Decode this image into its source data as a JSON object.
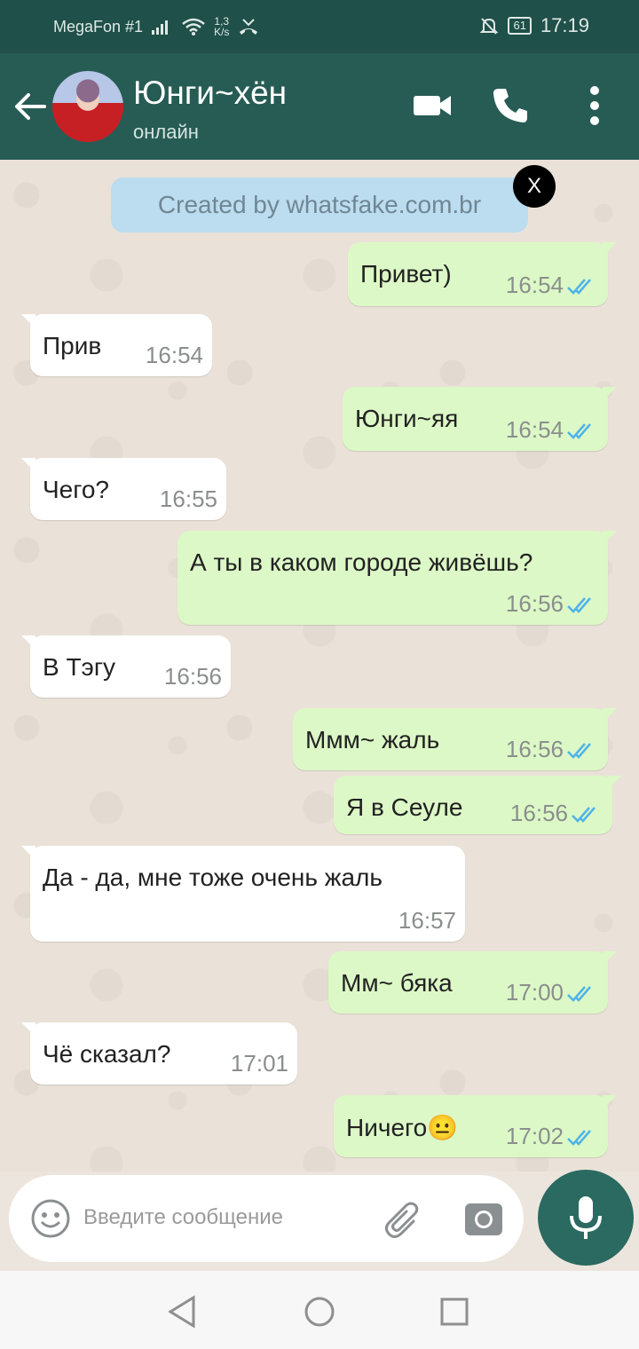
{
  "status_bar": {
    "carrier": "MegaFon #1",
    "speed_value": "1,3",
    "speed_unit": "K/s",
    "battery": "61",
    "time": "17:19"
  },
  "header": {
    "title": "Юнги~хён",
    "status": "онлайн"
  },
  "banner": {
    "text": "Created by whatsfake.com.br",
    "close": "X"
  },
  "messages": [
    {
      "dir": "out",
      "text": "Привет)",
      "time": "16:54"
    },
    {
      "dir": "in",
      "text": "Прив",
      "time": "16:54"
    },
    {
      "dir": "out",
      "text": "Юнги~яя",
      "time": "16:54"
    },
    {
      "dir": "in",
      "text": "Чего?",
      "time": "16:55"
    },
    {
      "dir": "out",
      "text": "А ты в каком городе живёшь?",
      "time": "16:56"
    },
    {
      "dir": "in",
      "text": "В Тэгу",
      "time": "16:56"
    },
    {
      "dir": "out",
      "text": "Ммм~ жаль",
      "time": "16:56"
    },
    {
      "dir": "out",
      "text": "Я в Сеуле",
      "time": "16:56"
    },
    {
      "dir": "in",
      "text": "Да - да, мне тоже очень жаль",
      "time": "16:57"
    },
    {
      "dir": "out",
      "text": "Мм~ бяка",
      "time": "17:00"
    },
    {
      "dir": "in",
      "text": "Чё сказал?",
      "time": "17:01"
    },
    {
      "dir": "out",
      "text": "Ничего😐",
      "time": "17:02"
    }
  ],
  "input": {
    "placeholder": "Введите сообщение"
  },
  "colors": {
    "header": "#275c55",
    "outgoing": "#dcf8c6",
    "incoming": "#ffffff",
    "ticks": "#4fb3e8"
  }
}
